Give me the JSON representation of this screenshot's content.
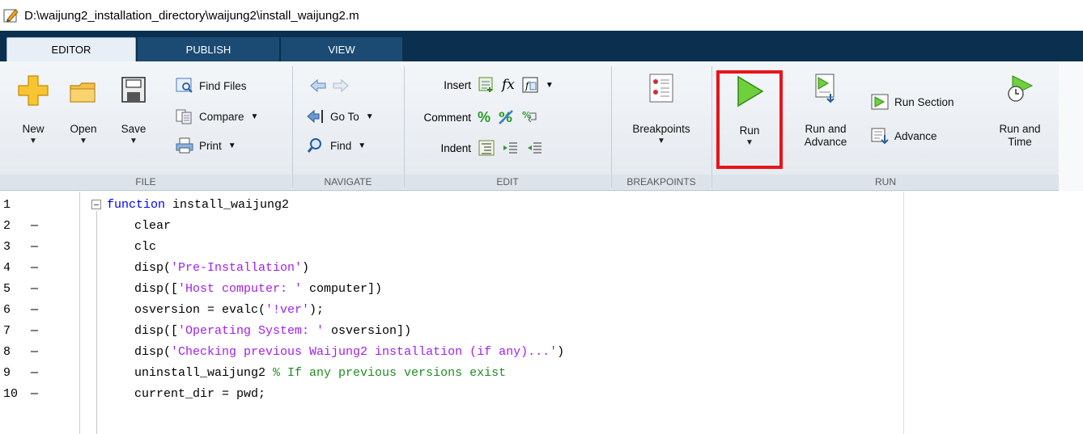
{
  "window": {
    "title": "D:\\waijung2_installation_directory\\waijung2\\install_waijung2.m",
    "icon": "edit-pencil-icon"
  },
  "tabs": [
    {
      "label": "EDITOR",
      "active": true
    },
    {
      "label": "PUBLISH",
      "active": false
    },
    {
      "label": "VIEW",
      "active": false
    }
  ],
  "ribbon": {
    "file": {
      "group_label": "FILE",
      "new_label": "New",
      "open_label": "Open",
      "save_label": "Save",
      "find_files_label": "Find Files",
      "compare_label": "Compare",
      "print_label": "Print"
    },
    "navigate": {
      "group_label": "NAVIGATE",
      "goto_label": "Go To",
      "find_label": "Find"
    },
    "edit": {
      "group_label": "EDIT",
      "insert_label": "Insert",
      "comment_label": "Comment",
      "indent_label": "Indent",
      "fx_label": "fx"
    },
    "breakpoints": {
      "group_label": "BREAKPOINTS",
      "breakpoints_label": "Breakpoints"
    },
    "run": {
      "group_label": "RUN",
      "run_label": "Run",
      "run_advance_line1": "Run and",
      "run_advance_line2": "Advance",
      "run_section_label": "Run Section",
      "advance_label": "Advance",
      "run_time_line1": "Run and",
      "run_time_line2": "Time"
    }
  },
  "colors": {
    "tab_strip": "#0b2f4e",
    "highlight": "#e8141a",
    "keyword": "#0000ff",
    "string": "#a020f0",
    "comment": "#228b22"
  },
  "code": {
    "lines": [
      {
        "num": "1",
        "dash": "",
        "parts": [
          {
            "t": "function",
            "c": "kw"
          },
          {
            "t": " install_waijung2",
            "c": "txt"
          }
        ]
      },
      {
        "num": "2",
        "dash": "—",
        "parts": [
          {
            "t": "clear",
            "c": "txt"
          }
        ]
      },
      {
        "num": "3",
        "dash": "—",
        "parts": [
          {
            "t": "clc",
            "c": "txt"
          }
        ]
      },
      {
        "num": "4",
        "dash": "—",
        "parts": [
          {
            "t": "disp(",
            "c": "txt"
          },
          {
            "t": "'Pre-Installation'",
            "c": "str"
          },
          {
            "t": ")",
            "c": "txt"
          }
        ]
      },
      {
        "num": "5",
        "dash": "—",
        "parts": [
          {
            "t": "disp([",
            "c": "txt"
          },
          {
            "t": "'Host computer: '",
            "c": "str"
          },
          {
            "t": " computer])",
            "c": "txt"
          }
        ]
      },
      {
        "num": "6",
        "dash": "—",
        "parts": [
          {
            "t": "osversion = evalc(",
            "c": "txt"
          },
          {
            "t": "'!ver'",
            "c": "str"
          },
          {
            "t": ");",
            "c": "txt"
          }
        ]
      },
      {
        "num": "7",
        "dash": "—",
        "parts": [
          {
            "t": "disp([",
            "c": "txt"
          },
          {
            "t": "'Operating System: '",
            "c": "str"
          },
          {
            "t": " osversion])",
            "c": "txt"
          }
        ]
      },
      {
        "num": "8",
        "dash": "—",
        "parts": [
          {
            "t": "disp(",
            "c": "txt"
          },
          {
            "t": "'Checking previous Waijung2 installation (if any)...'",
            "c": "str"
          },
          {
            "t": ")",
            "c": "txt"
          }
        ]
      },
      {
        "num": "9",
        "dash": "—",
        "parts": [
          {
            "t": "uninstall_waijung2 ",
            "c": "txt"
          },
          {
            "t": "% If any previous versions exist",
            "c": "cmt"
          }
        ]
      },
      {
        "num": "10",
        "dash": "—",
        "parts": [
          {
            "t": "current_dir = pwd;",
            "c": "txt"
          }
        ]
      }
    ]
  }
}
